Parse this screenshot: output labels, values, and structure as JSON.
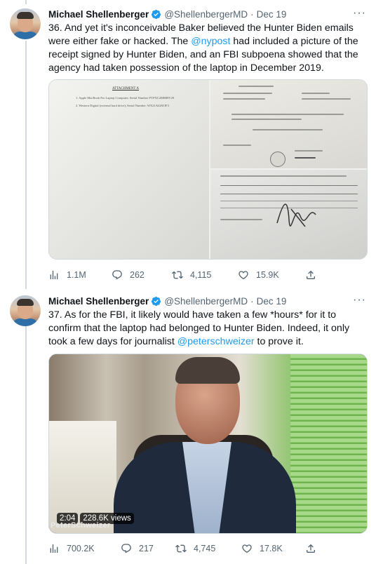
{
  "tweets": [
    {
      "author_name": "Michael Shellenberger",
      "handle": "@ShellenbergerMD",
      "separator": "·",
      "date": "Dec 19",
      "more": "···",
      "text_parts": [
        "36. And yet it's inconceivable Baker believed the Hunter Biden emails were either fake or hacked. The ",
        "@nypost",
        " had included a picture of the receipt signed by Hunter Biden, and an FBI subpoena showed that the agency had taken possession of the laptop in December 2019."
      ],
      "media": {
        "attachment_title": "ATTACHMENT A",
        "attachment_lines": [
          "1.  Apple MacBook Pro Laptop Computer; Serial Number FVFXC2MMHV29",
          "2.  Western Digital (external hard drive); Serial Number: WX21AI4ATJF3"
        ]
      },
      "stats": {
        "views": "1.1M",
        "replies": "262",
        "retweets": "4,115",
        "likes": "15.9K"
      },
      "icons": [
        "views-icon",
        "reply-icon",
        "retweet-icon",
        "like-icon",
        "share-icon"
      ]
    },
    {
      "author_name": "Michael Shellenberger",
      "handle": "@ShellenbergerMD",
      "separator": "·",
      "date": "Dec 19",
      "more": "···",
      "text_parts": [
        "37. As for the FBI, it likely would have taken a few *hours* for it to confirm that the laptop had belonged to Hunter Biden. Indeed, it only took a few days for journalist ",
        "@peterschweizer",
        " to prove it."
      ],
      "media": {
        "duration": "2:04",
        "view_count": "228.6K views",
        "watermark": "PeterSchweizer"
      },
      "stats": {
        "views": "700.2K",
        "replies": "217",
        "retweets": "4,745",
        "likes": "17.8K"
      },
      "icons": [
        "views-icon",
        "reply-icon",
        "retweet-icon",
        "like-icon",
        "share-icon"
      ]
    }
  ],
  "colors": {
    "accent": "#1d9bf0",
    "secondary_text": "#536471",
    "verified": "#1d9bf0",
    "border": "#cfd9de"
  }
}
